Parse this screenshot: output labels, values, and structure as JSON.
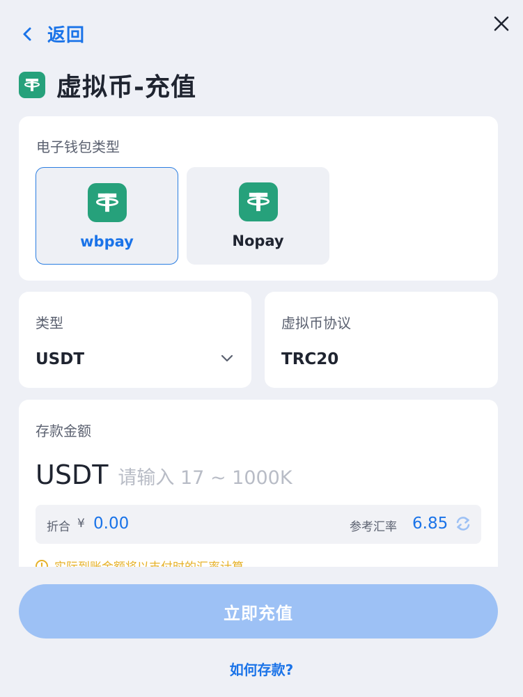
{
  "header": {
    "back_label": "返回",
    "title": "虚拟币-充值"
  },
  "wallet": {
    "label": "电子钱包类型",
    "options": [
      {
        "name": "wbpay",
        "selected": true
      },
      {
        "name": "Nopay",
        "selected": false
      }
    ]
  },
  "type": {
    "label": "类型",
    "value": "USDT"
  },
  "protocol": {
    "label": "虚拟币协议",
    "value": "TRC20"
  },
  "amount": {
    "label": "存款金额",
    "currency": "USDT",
    "placeholder": "请输入 17 ~ 1000K",
    "convert_label": "折合",
    "convert_symbol": "¥",
    "convert_value": "0.00",
    "rate_label": "参考汇率",
    "rate_value": "6.85",
    "note": "实际到账金额将以支付时的汇率计算"
  },
  "submit_label": "立即充值",
  "help_link": "如何存款?",
  "colors": {
    "accent": "#1a73e8",
    "tether": "#26a17b",
    "button_disabled": "#9dc1f5",
    "warning": "#e6b128",
    "background": "#eef0f6"
  },
  "icons": [
    "back-chevron-icon",
    "close-icon",
    "tether-icon",
    "chevron-down-icon",
    "refresh-icon",
    "info-icon"
  ]
}
